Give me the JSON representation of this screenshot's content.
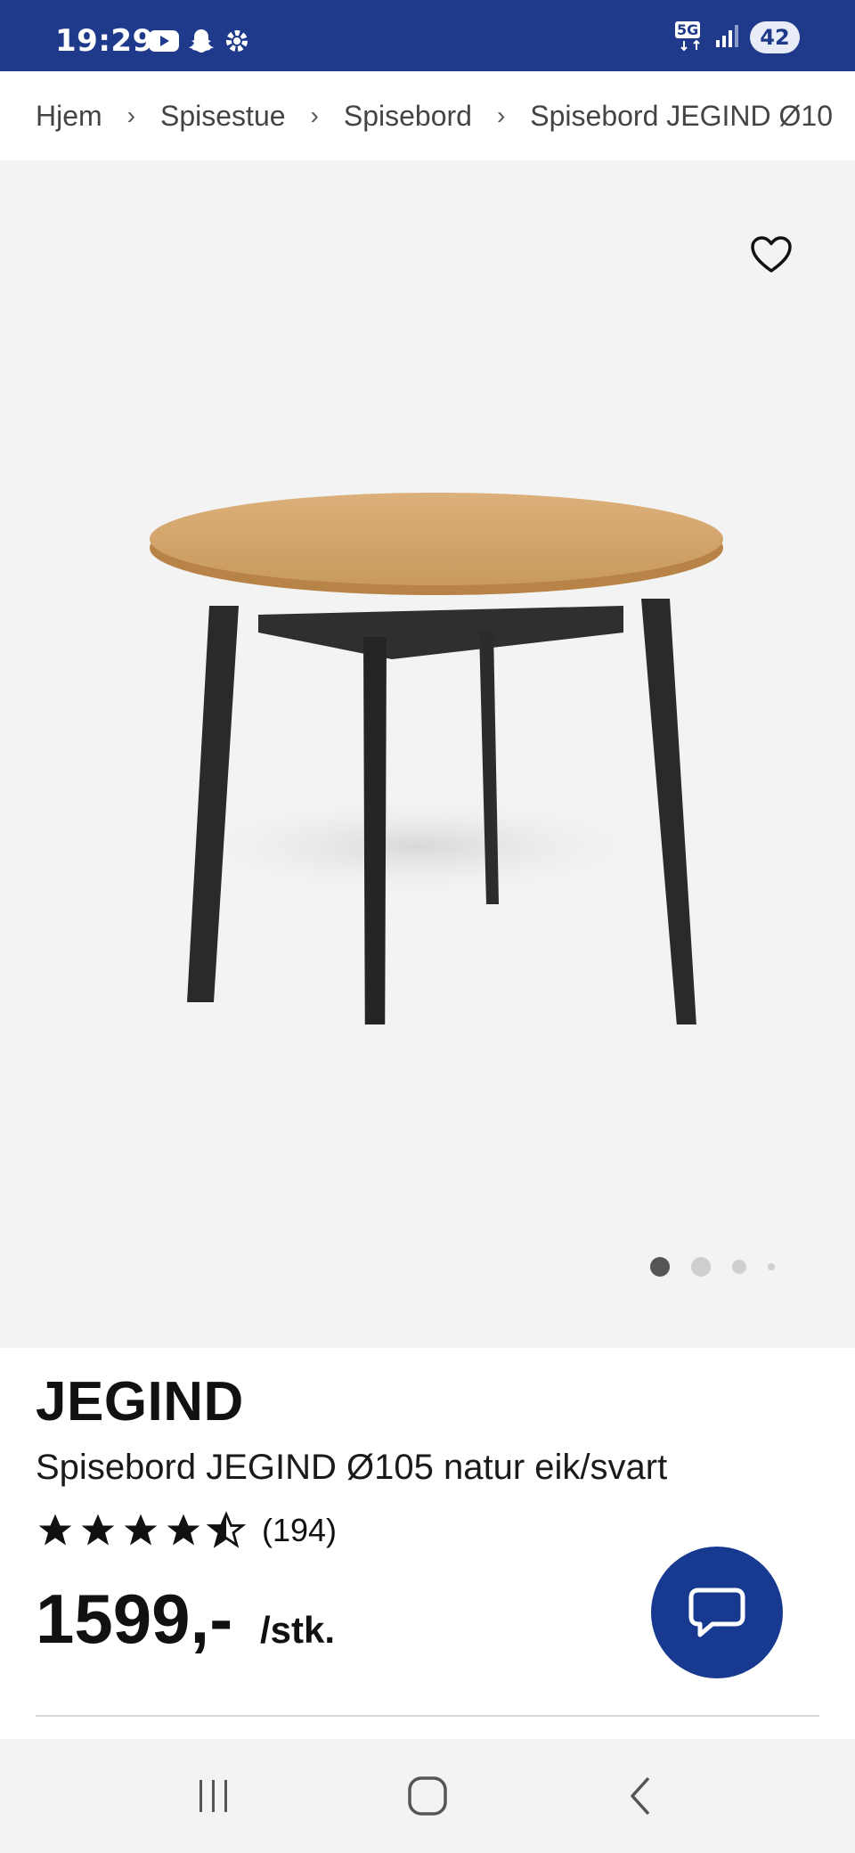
{
  "status_bar": {
    "time": "19:29",
    "network": "5G",
    "battery": "42",
    "icons": [
      "youtube-icon",
      "snapchat-icon",
      "settings-icon",
      "signal-icon"
    ]
  },
  "breadcrumb": [
    {
      "label": "Hjem"
    },
    {
      "label": "Spisestue"
    },
    {
      "label": "Spisebord"
    },
    {
      "label": "Spisebord JEGIND Ø10"
    }
  ],
  "gallery": {
    "image_count": 4,
    "active_index": 0,
    "favorite_icon": "heart-outline-icon"
  },
  "product": {
    "brand": "JEGIND",
    "name": "Spisebord JEGIND Ø105 natur eik/svart",
    "rating": 4.5,
    "rating_max": 5,
    "review_count": "(194)",
    "price": "1599,-",
    "unit": "/stk."
  },
  "chat": {
    "icon": "chat-bubble-icon"
  },
  "colors": {
    "status_bar": "#1f3a8a",
    "accent": "#17398f",
    "gallery_bg": "#f3f3f3",
    "table_top": "#d4a468",
    "table_legs": "#2b2b2b"
  },
  "nav": {
    "icons": [
      "recent-apps-icon",
      "home-icon",
      "back-icon"
    ]
  }
}
